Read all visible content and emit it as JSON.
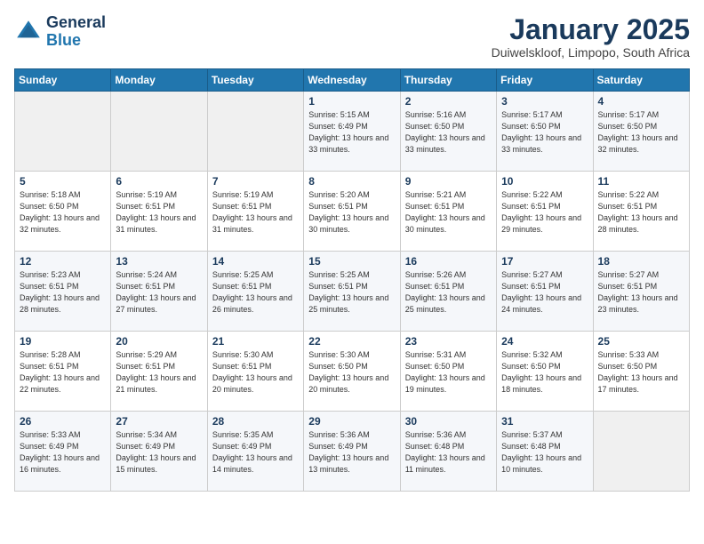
{
  "header": {
    "logo_line1": "General",
    "logo_line2": "Blue",
    "month": "January 2025",
    "location": "Duiwelskloof, Limpopo, South Africa"
  },
  "weekdays": [
    "Sunday",
    "Monday",
    "Tuesday",
    "Wednesday",
    "Thursday",
    "Friday",
    "Saturday"
  ],
  "weeks": [
    [
      {
        "day": "",
        "info": ""
      },
      {
        "day": "",
        "info": ""
      },
      {
        "day": "",
        "info": ""
      },
      {
        "day": "1",
        "info": "Sunrise: 5:15 AM\nSunset: 6:49 PM\nDaylight: 13 hours\nand 33 minutes."
      },
      {
        "day": "2",
        "info": "Sunrise: 5:16 AM\nSunset: 6:50 PM\nDaylight: 13 hours\nand 33 minutes."
      },
      {
        "day": "3",
        "info": "Sunrise: 5:17 AM\nSunset: 6:50 PM\nDaylight: 13 hours\nand 33 minutes."
      },
      {
        "day": "4",
        "info": "Sunrise: 5:17 AM\nSunset: 6:50 PM\nDaylight: 13 hours\nand 32 minutes."
      }
    ],
    [
      {
        "day": "5",
        "info": "Sunrise: 5:18 AM\nSunset: 6:50 PM\nDaylight: 13 hours\nand 32 minutes."
      },
      {
        "day": "6",
        "info": "Sunrise: 5:19 AM\nSunset: 6:51 PM\nDaylight: 13 hours\nand 31 minutes."
      },
      {
        "day": "7",
        "info": "Sunrise: 5:19 AM\nSunset: 6:51 PM\nDaylight: 13 hours\nand 31 minutes."
      },
      {
        "day": "8",
        "info": "Sunrise: 5:20 AM\nSunset: 6:51 PM\nDaylight: 13 hours\nand 30 minutes."
      },
      {
        "day": "9",
        "info": "Sunrise: 5:21 AM\nSunset: 6:51 PM\nDaylight: 13 hours\nand 30 minutes."
      },
      {
        "day": "10",
        "info": "Sunrise: 5:22 AM\nSunset: 6:51 PM\nDaylight: 13 hours\nand 29 minutes."
      },
      {
        "day": "11",
        "info": "Sunrise: 5:22 AM\nSunset: 6:51 PM\nDaylight: 13 hours\nand 28 minutes."
      }
    ],
    [
      {
        "day": "12",
        "info": "Sunrise: 5:23 AM\nSunset: 6:51 PM\nDaylight: 13 hours\nand 28 minutes."
      },
      {
        "day": "13",
        "info": "Sunrise: 5:24 AM\nSunset: 6:51 PM\nDaylight: 13 hours\nand 27 minutes."
      },
      {
        "day": "14",
        "info": "Sunrise: 5:25 AM\nSunset: 6:51 PM\nDaylight: 13 hours\nand 26 minutes."
      },
      {
        "day": "15",
        "info": "Sunrise: 5:25 AM\nSunset: 6:51 PM\nDaylight: 13 hours\nand 25 minutes."
      },
      {
        "day": "16",
        "info": "Sunrise: 5:26 AM\nSunset: 6:51 PM\nDaylight: 13 hours\nand 25 minutes."
      },
      {
        "day": "17",
        "info": "Sunrise: 5:27 AM\nSunset: 6:51 PM\nDaylight: 13 hours\nand 24 minutes."
      },
      {
        "day": "18",
        "info": "Sunrise: 5:27 AM\nSunset: 6:51 PM\nDaylight: 13 hours\nand 23 minutes."
      }
    ],
    [
      {
        "day": "19",
        "info": "Sunrise: 5:28 AM\nSunset: 6:51 PM\nDaylight: 13 hours\nand 22 minutes."
      },
      {
        "day": "20",
        "info": "Sunrise: 5:29 AM\nSunset: 6:51 PM\nDaylight: 13 hours\nand 21 minutes."
      },
      {
        "day": "21",
        "info": "Sunrise: 5:30 AM\nSunset: 6:51 PM\nDaylight: 13 hours\nand 20 minutes."
      },
      {
        "day": "22",
        "info": "Sunrise: 5:30 AM\nSunset: 6:50 PM\nDaylight: 13 hours\nand 20 minutes."
      },
      {
        "day": "23",
        "info": "Sunrise: 5:31 AM\nSunset: 6:50 PM\nDaylight: 13 hours\nand 19 minutes."
      },
      {
        "day": "24",
        "info": "Sunrise: 5:32 AM\nSunset: 6:50 PM\nDaylight: 13 hours\nand 18 minutes."
      },
      {
        "day": "25",
        "info": "Sunrise: 5:33 AM\nSunset: 6:50 PM\nDaylight: 13 hours\nand 17 minutes."
      }
    ],
    [
      {
        "day": "26",
        "info": "Sunrise: 5:33 AM\nSunset: 6:49 PM\nDaylight: 13 hours\nand 16 minutes."
      },
      {
        "day": "27",
        "info": "Sunrise: 5:34 AM\nSunset: 6:49 PM\nDaylight: 13 hours\nand 15 minutes."
      },
      {
        "day": "28",
        "info": "Sunrise: 5:35 AM\nSunset: 6:49 PM\nDaylight: 13 hours\nand 14 minutes."
      },
      {
        "day": "29",
        "info": "Sunrise: 5:36 AM\nSunset: 6:49 PM\nDaylight: 13 hours\nand 13 minutes."
      },
      {
        "day": "30",
        "info": "Sunrise: 5:36 AM\nSunset: 6:48 PM\nDaylight: 13 hours\nand 11 minutes."
      },
      {
        "day": "31",
        "info": "Sunrise: 5:37 AM\nSunset: 6:48 PM\nDaylight: 13 hours\nand 10 minutes."
      },
      {
        "day": "",
        "info": ""
      }
    ]
  ]
}
